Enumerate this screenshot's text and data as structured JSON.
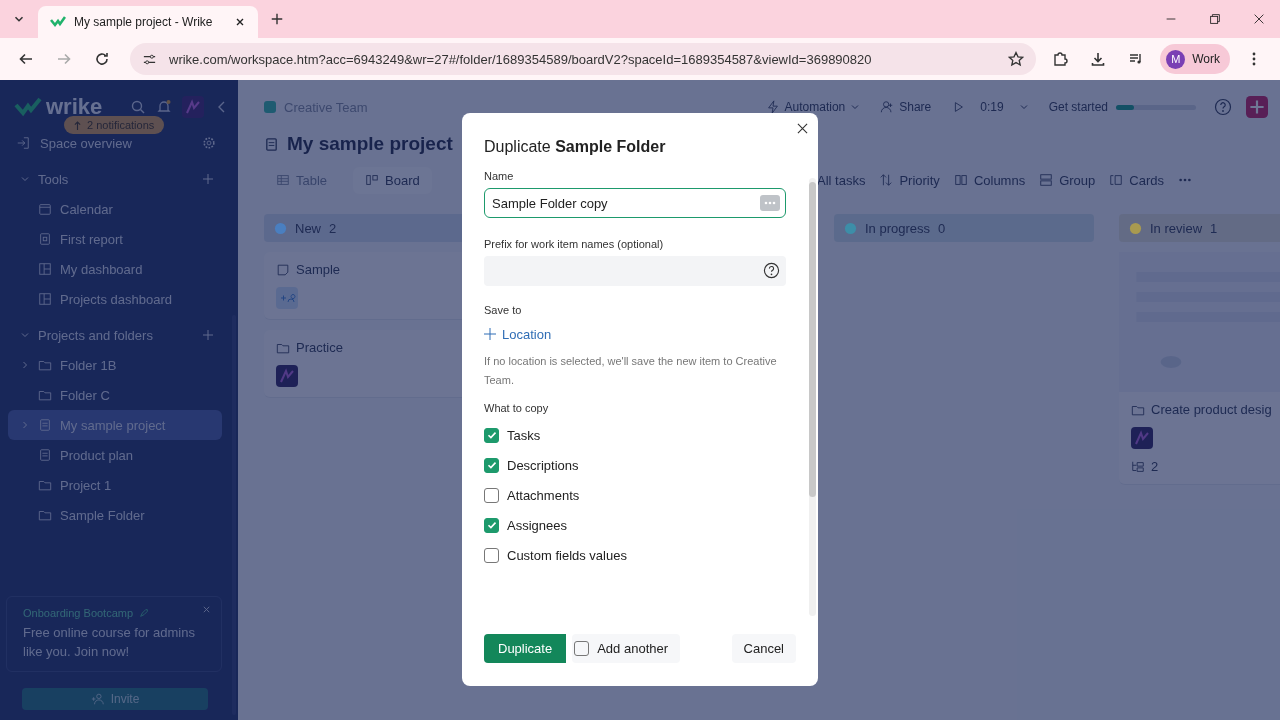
{
  "browser": {
    "tabs": [
      {
        "title": "My sample project - Wrike",
        "selected": true
      }
    ],
    "url": "wrike.com/workspace.htm?acc=6943249&wr=27#/folder/1689354589/boardV2?spaceId=1689354587&viewId=369890820",
    "profile": {
      "initial": "M",
      "label": "Work"
    }
  },
  "sidebar": {
    "logo": "wrike",
    "notifications_badge": "2 notifications",
    "space_overview": "Space overview",
    "sections": [
      {
        "title": "Tools",
        "expanded": true,
        "items": [
          {
            "label": "Calendar",
            "kind": "calendar",
            "expandable": false,
            "selected": false
          },
          {
            "label": "First report",
            "kind": "report",
            "expandable": false,
            "selected": false
          },
          {
            "label": "My dashboard",
            "kind": "dashboard",
            "expandable": false,
            "selected": false
          },
          {
            "label": "Projects dashboard",
            "kind": "dashboard",
            "expandable": false,
            "selected": false
          }
        ]
      },
      {
        "title": "Projects and folders",
        "expanded": true,
        "items": [
          {
            "label": "Folder 1B",
            "kind": "folder",
            "expandable": true,
            "selected": false
          },
          {
            "label": "Folder C",
            "kind": "folder",
            "expandable": false,
            "selected": false
          },
          {
            "label": "My sample project",
            "kind": "project",
            "expandable": true,
            "selected": true
          },
          {
            "label": "Product plan",
            "kind": "project",
            "expandable": false,
            "selected": false
          },
          {
            "label": "Project 1",
            "kind": "folder",
            "expandable": false,
            "selected": false
          },
          {
            "label": "Sample Folder",
            "kind": "folder",
            "expandable": false,
            "selected": false
          }
        ]
      }
    ],
    "onboarding": {
      "title": "Onboarding Bootcamp",
      "text": "Free online course for admins like you. Join now!"
    },
    "invite_button": "Invite"
  },
  "main": {
    "breadcrumb": "Creative Team",
    "title": "My sample project",
    "toolbar": {
      "automation": "Automation",
      "share": "Share",
      "timer": "0:19",
      "get_started": {
        "label": "Get started",
        "level": 0.22
      }
    },
    "view_tabs": [
      {
        "label": "Table",
        "selected": false
      },
      {
        "label": "Board",
        "selected": true
      }
    ],
    "filters": [
      {
        "label": "All tasks",
        "kind": "none"
      },
      {
        "label": "Priority",
        "kind": "sort"
      },
      {
        "label": "Columns",
        "kind": "columns"
      },
      {
        "label": "Group",
        "kind": "group"
      },
      {
        "label": "Cards",
        "kind": "cards"
      }
    ],
    "columns": [
      {
        "title": "New",
        "count": "2",
        "color": "#4a7fc0",
        "cards": [
          {
            "title": "Sample",
            "kind": "task",
            "assignee": {
              "kind": "add"
            }
          },
          {
            "title": "Practice",
            "kind": "folder",
            "assignee": {
              "kind": "avatar"
            }
          }
        ]
      },
      {
        "title": "In progress",
        "count": "0",
        "color": "#3d8ea8"
      },
      {
        "title": "In review",
        "count": "1",
        "color": "#a89a50",
        "cards": [
          {
            "title": "Create product desig",
            "kind": "folder",
            "assignee": {
              "kind": "avatar"
            },
            "subtasks": "2"
          }
        ]
      }
    ]
  },
  "dialog": {
    "title": "Duplicate **Sample Folder**",
    "name_label": "Name",
    "name_value": "Sample Folder copy",
    "prefix_label": "Prefix for work item names (optional)",
    "save_to_label": "Save to",
    "location_link": "Location",
    "hint": "If no location is selected, we'll save the new item to Creative Team.",
    "copy_label": "What to copy",
    "options": [
      {
        "label": "Tasks",
        "checked": true
      },
      {
        "label": "Descriptions",
        "checked": true
      },
      {
        "label": "Attachments",
        "checked": false
      },
      {
        "label": "Assignees",
        "checked": true
      },
      {
        "label": "Custom fields values",
        "checked": false
      }
    ],
    "primary_button": "Duplicate",
    "add_another": {
      "label": "Add another",
      "checked": false
    },
    "cancel_button": "Cancel"
  }
}
